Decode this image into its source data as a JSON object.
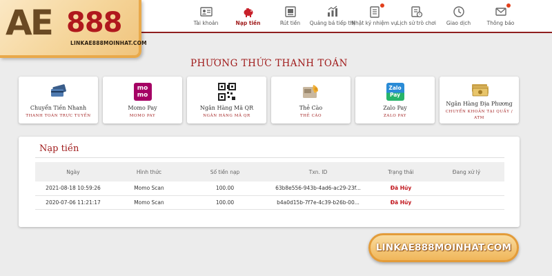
{
  "logo": {
    "brand_a": "AE",
    "brand_b": "888",
    "link": "LINKAE888MOINHAT.COM"
  },
  "nav": {
    "items": [
      {
        "label": "Tài khoản",
        "icon": "id-card-icon",
        "active": false,
        "dot": false
      },
      {
        "label": "Nạp tiền",
        "icon": "piggy-bank-icon",
        "active": true,
        "dot": false
      },
      {
        "label": "Rút tiền",
        "icon": "withdraw-icon",
        "active": false,
        "dot": false
      },
      {
        "label": "Quảng bá tiếp thị",
        "icon": "promotion-icon",
        "active": false,
        "dot": false
      },
      {
        "label": "Nhật ký nhiệm vụ",
        "icon": "task-log-icon",
        "active": false,
        "dot": true
      },
      {
        "label": "Lịch sử trò chơi",
        "icon": "game-history-icon",
        "active": false,
        "dot": false
      },
      {
        "label": "Giao dịch",
        "icon": "clock-icon",
        "active": false,
        "dot": false
      },
      {
        "label": "Thông báo",
        "icon": "mail-icon",
        "active": false,
        "dot": true
      }
    ]
  },
  "payment": {
    "title": "PHƯƠNG THỨC THANH TOÁN",
    "methods": [
      {
        "title": "Chuyển Tiền Nhanh",
        "subtitle": "THANH TOÁN TRỰC TUYẾN",
        "icon": "cards-icon",
        "icon_text": ""
      },
      {
        "title": "Momo Pay",
        "subtitle": "MOMO PAY",
        "icon": "momo-logo-icon",
        "icon_text": "mo mo"
      },
      {
        "title": "Ngân Hàng Mã QR",
        "subtitle": "NGÂN HÀNG MÃ QR",
        "icon": "qr-code-icon",
        "icon_text": ""
      },
      {
        "title": "Thẻ Cào",
        "subtitle": "THẺ CÀO",
        "icon": "scratch-card-icon",
        "icon_text": ""
      },
      {
        "title": "Zalo Pay",
        "subtitle": "ZALO PAY",
        "icon": "zalopay-logo-icon",
        "icon_text": "Zalo Pay"
      },
      {
        "title": "Ngân Hàng Địa Phương",
        "subtitle": "CHUYỂN KHOẢN TẠI QUẦY / ATM",
        "icon": "cash-icon",
        "icon_text": ""
      }
    ]
  },
  "deposit": {
    "title": "Nạp tiền",
    "columns": [
      "Ngày",
      "Hình thức",
      "Số tiền nạp",
      "Txn. ID",
      "Trạng thái",
      "Đang xử lý"
    ],
    "rows": [
      [
        "2021-08-18 10:59:26",
        "Momo Scan",
        "100.00",
        "63b8e556-943b-4ad6-ac29-23f...",
        "Đã Hủy",
        ""
      ],
      [
        "2020-07-06 11:21:17",
        "Momo Scan",
        "100.00",
        "b4a0d15b-7f7e-4c39-b26b-00...",
        "Đã Hủy",
        ""
      ]
    ]
  },
  "badge": {
    "text": "LINKAE888MOINHAT.COM"
  },
  "colors": {
    "accent": "#a01b1b",
    "status_cancelled": "#c0141b",
    "background": "#ececec",
    "logo_gold": "#f0c47d"
  }
}
